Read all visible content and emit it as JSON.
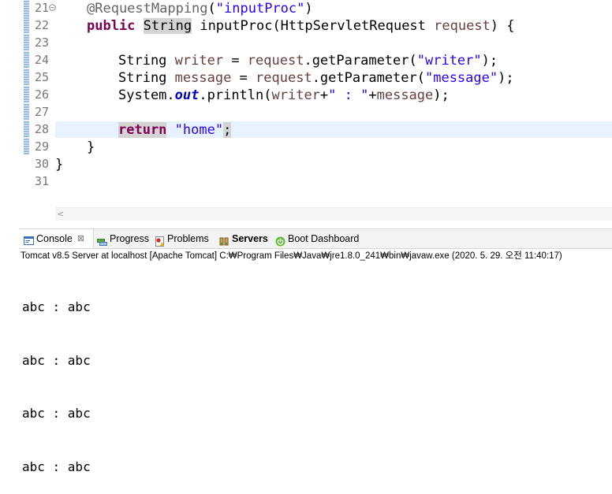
{
  "editor": {
    "line_numbers": [
      "21",
      "22",
      "23",
      "24",
      "25",
      "26",
      "27",
      "28",
      "29",
      "30",
      "31"
    ],
    "annotation": "@RequestMapping",
    "annotation_arg": "\"inputProc\"",
    "kw_public": "public",
    "type_string": "String",
    "method_sig": " inputProc(HttpServletRequest ",
    "param_request": "request",
    "method_sig_end": ") {",
    "line24_type": "String ",
    "line24_var": "writer",
    "line24_mid": " = ",
    "line24_req": "request",
    "line24_call": ".getParameter(",
    "line24_arg": "\"writer\"",
    "line24_end": ");",
    "line25_type": "String ",
    "line25_var": "message",
    "line25_mid": " = ",
    "line25_req": "request",
    "line25_call": ".getParameter(",
    "line25_arg": "\"message\"",
    "line25_end": ");",
    "line26_sys": "System.",
    "line26_out": "out",
    "line26_call": ".println(",
    "line26_writer": "writer",
    "line26_plus": "+",
    "line26_sep": "\" : \"",
    "line26_plus2": "+",
    "line26_message": "message",
    "line26_end": ");",
    "kw_return": "return",
    "return_val": "\"home\"",
    "return_end": ";",
    "close_method": "}",
    "close_class": "}",
    "fold_icon": "collapse-icon"
  },
  "tabs": [
    {
      "label": "Console",
      "icon": "console-icon",
      "close": "⊠"
    },
    {
      "label": "Progress",
      "icon": "progress-icon"
    },
    {
      "label": "Problems",
      "icon": "problems-icon"
    },
    {
      "label": "Servers",
      "icon": "servers-icon"
    },
    {
      "label": "Boot Dashboard",
      "icon": "boot-dashboard-icon"
    }
  ],
  "console": {
    "status": "Tomcat v8.5 Server at localhost [Apache Tomcat] C:₩Program Files₩Java₩jre1.8.0_241₩bin₩javaw.exe (2020. 5. 29. 오전 11:40:17)",
    "output": [
      "abc : abc",
      "abc : abc",
      "abc : abc",
      "abc : abc"
    ]
  },
  "colors": {
    "keyword": "#7f0055",
    "string": "#2a00ff",
    "field": "#0000c0",
    "variable": "#6a3e3e",
    "current_line": "#e8f2fe"
  }
}
